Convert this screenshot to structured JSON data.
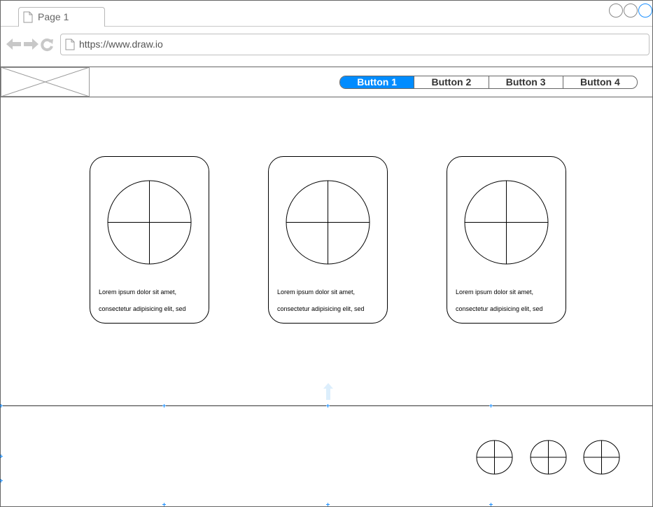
{
  "browser": {
    "tab_label": "Page 1",
    "url": "https://www.draw.io"
  },
  "header": {
    "buttons": [
      {
        "label": "Button 1",
        "active": true
      },
      {
        "label": "Button 2",
        "active": false
      },
      {
        "label": "Button 3",
        "active": false
      },
      {
        "label": "Button 4",
        "active": false
      }
    ]
  },
  "cards": [
    {
      "line1": "Lorem ipsum dolor sit amet,",
      "line2": "consectetur adipisicing elit, sed"
    },
    {
      "line1": "Lorem ipsum dolor sit amet,",
      "line2": "consectetur adipisicing elit, sed"
    },
    {
      "line1": "Lorem ipsum dolor sit amet,",
      "line2": "consectetur adipisicing elit, sed"
    }
  ],
  "colors": {
    "accent": "#008cff",
    "selection": "#1e90ff",
    "nav_icon": "#c8c8c8"
  }
}
